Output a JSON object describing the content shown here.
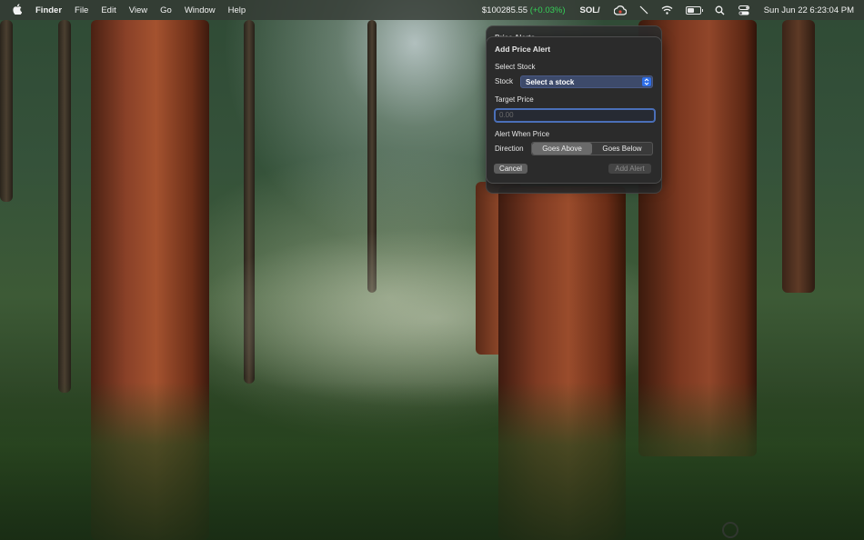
{
  "menubar": {
    "app_name": "Finder",
    "items": [
      "File",
      "Edit",
      "View",
      "Go",
      "Window",
      "Help"
    ],
    "status": {
      "portfolio_value": "$100285.55",
      "portfolio_change": "(+0.03%)",
      "ticker": "SOL/",
      "battery_level": 0.55,
      "datetime": "Sun Jun 22  6:23:04 PM"
    }
  },
  "background_panel": {
    "title": "Price Alerts"
  },
  "add_alert": {
    "title": "Add Price Alert",
    "select_section": "Select Stock",
    "stock_label": "Stock",
    "stock_value": "Select a stock",
    "target_section": "Target Price",
    "price_placeholder": "0.00",
    "alert_section": "Alert When Price",
    "direction_label": "Direction",
    "direction_options": [
      "Goes Above",
      "Goes Below"
    ],
    "direction_selected": "Goes Above",
    "cancel_label": "Cancel",
    "add_label": "Add Alert"
  },
  "colors": {
    "accent": "#2f6fe8",
    "positive": "#36d058"
  }
}
